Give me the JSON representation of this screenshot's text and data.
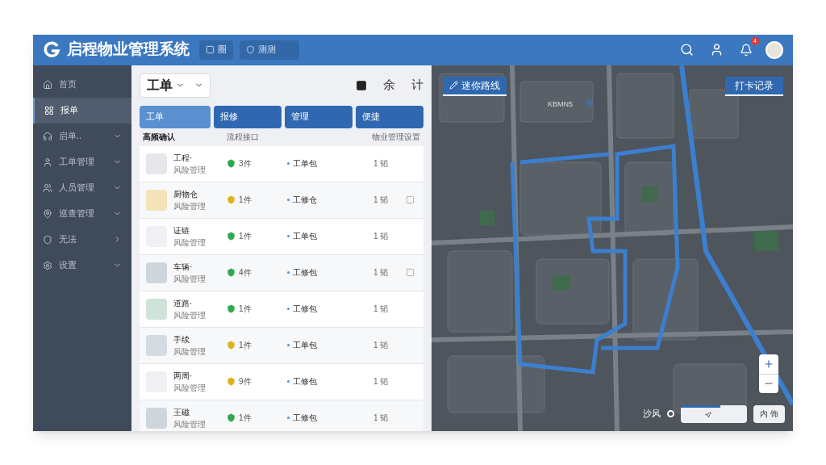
{
  "header": {
    "title": "启程物业管理系统",
    "chips": [
      {
        "label": "圈"
      },
      {
        "label": "测测"
      }
    ],
    "notification_count": "4"
  },
  "sidebar": {
    "items": [
      {
        "label": "首页",
        "selected": false,
        "expandable": false
      },
      {
        "label": "报单",
        "selected": true,
        "expandable": false
      },
      {
        "label": "启单..",
        "selected": false,
        "expandable": true
      },
      {
        "label": "工单管理",
        "selected": false,
        "expandable": true
      },
      {
        "label": "人员管理",
        "selected": false,
        "expandable": true
      },
      {
        "label": "巡查管理",
        "selected": false,
        "expandable": true
      },
      {
        "label": "无法",
        "selected": false,
        "expandable": true
      },
      {
        "label": "设置",
        "selected": false,
        "expandable": true
      }
    ]
  },
  "panel": {
    "dropdown": "工单",
    "tools": [
      "余",
      "计"
    ],
    "tabs": [
      {
        "label": "工单",
        "selected": true
      },
      {
        "label": "报修",
        "selected": false
      },
      {
        "label": "管理",
        "selected": false
      },
      {
        "label": "便捷",
        "selected": false
      }
    ],
    "header_row": [
      "高频确认",
      "流程接口",
      "物业管理设置"
    ],
    "rows": [
      {
        "name": "工程·",
        "sub": "风险管理",
        "color": "#2fa84f",
        "count": "3件",
        "status": "工单包",
        "right": "1 韬",
        "action": false
      },
      {
        "name": "厨物仓",
        "sub": "风险管理",
        "color": "#e0b21a",
        "count": "1件",
        "status": "工修仓",
        "right": "1 韬",
        "action": true
      },
      {
        "name": "证链",
        "sub": "风险管理",
        "color": "#2fa84f",
        "count": "1件",
        "status": "工单包",
        "right": "1 韬",
        "action": false
      },
      {
        "name": "车辆·",
        "sub": "风险管理",
        "color": "#2fa84f",
        "count": "4件",
        "status": "工修包",
        "right": "1 韬",
        "action": true
      },
      {
        "name": "道路·",
        "sub": "风险管理",
        "color": "#2fa84f",
        "count": "1件",
        "status": "工修包",
        "right": "1 韬",
        "action": false
      },
      {
        "name": "手续",
        "sub": "风险管理",
        "color": "#e0b21a",
        "count": "1件",
        "status": "工单包",
        "right": "1 韬",
        "action": false
      },
      {
        "name": "两周·",
        "sub": "风险管理",
        "color": "#e0b21a",
        "count": "9件",
        "status": "工修包",
        "right": "1 韬",
        "action": false
      },
      {
        "name": "王磁",
        "sub": "风险管理",
        "color": "#2fa84f",
        "count": "1件",
        "status": "工修包",
        "right": "1 韬",
        "action": false
      }
    ]
  },
  "map": {
    "route_button": "迷你路线",
    "record_button": "打卡记录",
    "label": "KBMN5",
    "distance_label": "沙风",
    "progress": {
      "level": 0.6
    },
    "bottom_button": "内 饰"
  }
}
